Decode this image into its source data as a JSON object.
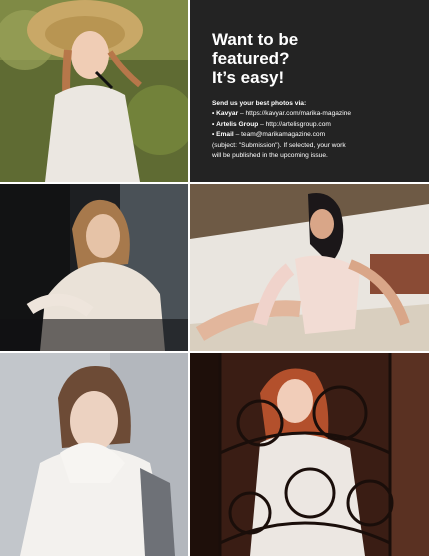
{
  "panel": {
    "headline": [
      "Want to be",
      "featured?",
      "It’s easy!"
    ],
    "intro": "Send us your best photos via:",
    "channels": [
      {
        "bullet": "•",
        "name": "Kavyar",
        "detail": " – https://kavyar.com/marika-magazine"
      },
      {
        "bullet": "•",
        "name": "Artelis Group",
        "detail": " – http://artelisgroup.com"
      },
      {
        "bullet": "•",
        "name": "Email",
        "detail": " – team@marikamagazine.com"
      }
    ],
    "note_lines": [
      "(subject: \"Submission\"). If selected, your work",
      "will be published in the upcoming issue."
    ]
  },
  "colors": {
    "panel_background": "#232323",
    "panel_text": "#ffffff",
    "gutter": "#ffffff"
  }
}
